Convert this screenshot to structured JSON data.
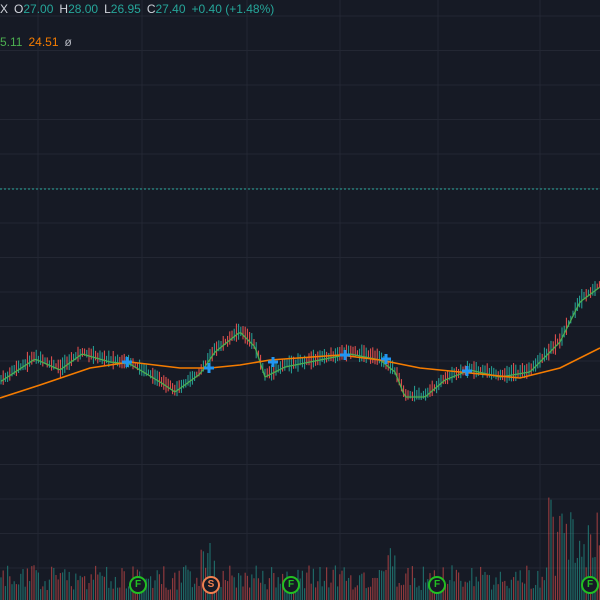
{
  "ohlc": {
    "symbol_tail": "X",
    "open_label": "O",
    "open": "27.00",
    "high_label": "H",
    "high": "28.00",
    "low_label": "L",
    "low": "26.95",
    "close_label": "C",
    "close": "27.40",
    "change": "+0.40 (+1.48%)"
  },
  "indicators": {
    "ma_fast": "5.11",
    "ma_slow": "24.51",
    "hidden_icon": "ø"
  },
  "markers": [
    {
      "letter": "F",
      "type": "F"
    },
    {
      "letter": "S",
      "type": "S"
    },
    {
      "letter": "F",
      "type": "F"
    },
    {
      "letter": "F",
      "type": "F"
    },
    {
      "letter": "F",
      "type": "F"
    }
  ],
  "colors": {
    "background": "#161a25",
    "up": "#26a69a",
    "down": "#ef5350",
    "ma_fast": "#4caf50",
    "ma_slow": "#f57c00",
    "cross": "#2196f3",
    "grid": "#232733"
  }
}
